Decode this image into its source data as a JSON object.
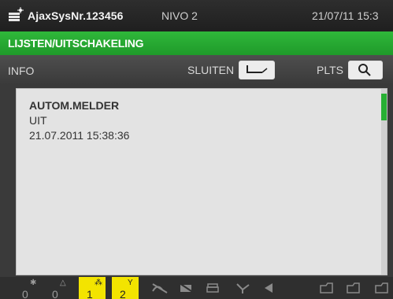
{
  "header": {
    "system_name": "AjaxSysNr.123456",
    "level": "NIVO 2",
    "datetime": "21/07/11 15:3",
    "logo_icon": "ajax-logo-icon"
  },
  "breadcrumb": {
    "text": "LIJSTEN/UITSCHAKELING"
  },
  "toolbar": {
    "info_label": "INFO",
    "close_label": "SLUITEN",
    "close_icon": "return-arrow-icon",
    "position_label": "PLTS",
    "position_icon": "magnifier-icon"
  },
  "event": {
    "title": "AUTOM.MELDER",
    "state": "UIT",
    "timestamp": "21.07.2011 15:38:36"
  },
  "bottom_tabs": [
    {
      "count": "0",
      "symbol": "✱",
      "highlighted": false
    },
    {
      "count": "0",
      "symbol": "△",
      "highlighted": false
    },
    {
      "count": "1",
      "symbol": "⁂",
      "highlighted": true
    },
    {
      "count": "2",
      "symbol": "Y",
      "highlighted": true
    }
  ],
  "bottom_icons": [
    "fire-off-icon",
    "sensor-off-icon",
    "printer-icon",
    "tool-icon",
    "speaker-icon",
    "folder-a-icon",
    "folder-b-icon",
    "folder-c-icon"
  ],
  "colors": {
    "accent_green": "#2fb83a",
    "highlight_yellow": "#f3e400"
  }
}
